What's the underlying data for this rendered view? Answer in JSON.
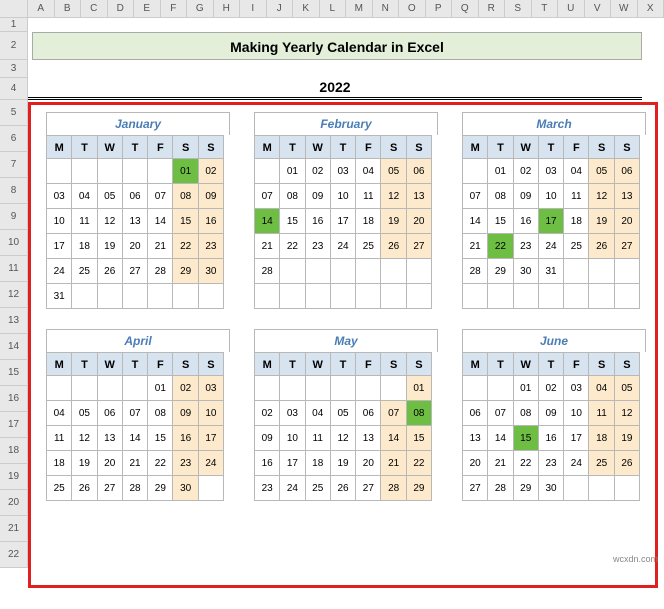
{
  "columns": [
    "A",
    "B",
    "C",
    "D",
    "E",
    "F",
    "G",
    "H",
    "I",
    "J",
    "K",
    "L",
    "M",
    "N",
    "O",
    "P",
    "Q",
    "R",
    "S",
    "T",
    "U",
    "V",
    "W",
    "X"
  ],
  "rows": [
    "1",
    "2",
    "3",
    "4",
    "5",
    "6",
    "7",
    "8",
    "9",
    "10",
    "11",
    "12",
    "13",
    "14",
    "15",
    "16",
    "17",
    "18",
    "19",
    "20",
    "21",
    "22"
  ],
  "title": "Making Yearly Calendar in Excel",
  "year": "2022",
  "dow": [
    "M",
    "T",
    "W",
    "T",
    "F",
    "S",
    "S"
  ],
  "watermark": "wcxdn.com",
  "months": [
    {
      "name": "January",
      "weeks": [
        [
          "",
          "",
          "",
          "",
          "",
          "01",
          "02"
        ],
        [
          "03",
          "04",
          "05",
          "06",
          "07",
          "08",
          "09"
        ],
        [
          "10",
          "11",
          "12",
          "13",
          "14",
          "15",
          "16"
        ],
        [
          "17",
          "18",
          "19",
          "20",
          "21",
          "22",
          "23"
        ],
        [
          "24",
          "25",
          "26",
          "27",
          "28",
          "29",
          "30"
        ],
        [
          "31",
          "",
          "",
          "",
          "",
          "",
          ""
        ]
      ],
      "highlights": [
        "01"
      ]
    },
    {
      "name": "February",
      "weeks": [
        [
          "",
          "01",
          "02",
          "03",
          "04",
          "05",
          "06"
        ],
        [
          "07",
          "08",
          "09",
          "10",
          "11",
          "12",
          "13"
        ],
        [
          "14",
          "15",
          "16",
          "17",
          "18",
          "19",
          "20"
        ],
        [
          "21",
          "22",
          "23",
          "24",
          "25",
          "26",
          "27"
        ],
        [
          "28",
          "",
          "",
          "",
          "",
          "",
          ""
        ],
        [
          "",
          "",
          "",
          "",
          "",
          "",
          ""
        ]
      ],
      "highlights": [
        "14"
      ]
    },
    {
      "name": "March",
      "weeks": [
        [
          "",
          "01",
          "02",
          "03",
          "04",
          "05",
          "06"
        ],
        [
          "07",
          "08",
          "09",
          "10",
          "11",
          "12",
          "13"
        ],
        [
          "14",
          "15",
          "16",
          "17",
          "18",
          "19",
          "20"
        ],
        [
          "21",
          "22",
          "23",
          "24",
          "25",
          "26",
          "27"
        ],
        [
          "28",
          "29",
          "30",
          "31",
          "",
          "",
          ""
        ],
        [
          "",
          "",
          "",
          "",
          "",
          "",
          ""
        ]
      ],
      "highlights": [
        "17",
        "22"
      ]
    },
    {
      "name": "April",
      "weeks": [
        [
          "",
          "",
          "",
          "",
          "01",
          "02",
          "03"
        ],
        [
          "04",
          "05",
          "06",
          "07",
          "08",
          "09",
          "10"
        ],
        [
          "11",
          "12",
          "13",
          "14",
          "15",
          "16",
          "17"
        ],
        [
          "18",
          "19",
          "20",
          "21",
          "22",
          "23",
          "24"
        ],
        [
          "25",
          "26",
          "27",
          "28",
          "29",
          "30",
          ""
        ]
      ],
      "highlights": []
    },
    {
      "name": "May",
      "weeks": [
        [
          "",
          "",
          "",
          "",
          "",
          "",
          "01"
        ],
        [
          "02",
          "03",
          "04",
          "05",
          "06",
          "07",
          "08"
        ],
        [
          "09",
          "10",
          "11",
          "12",
          "13",
          "14",
          "15"
        ],
        [
          "16",
          "17",
          "18",
          "19",
          "20",
          "21",
          "22"
        ],
        [
          "23",
          "24",
          "25",
          "26",
          "27",
          "28",
          "29"
        ]
      ],
      "highlights": [
        "08"
      ]
    },
    {
      "name": "June",
      "weeks": [
        [
          "",
          "",
          "01",
          "02",
          "03",
          "04",
          "05"
        ],
        [
          "06",
          "07",
          "08",
          "09",
          "10",
          "11",
          "12"
        ],
        [
          "13",
          "14",
          "15",
          "16",
          "17",
          "18",
          "19"
        ],
        [
          "20",
          "21",
          "22",
          "23",
          "24",
          "25",
          "26"
        ],
        [
          "27",
          "28",
          "29",
          "30",
          "",
          "",
          ""
        ]
      ],
      "highlights": [
        "15"
      ]
    }
  ]
}
